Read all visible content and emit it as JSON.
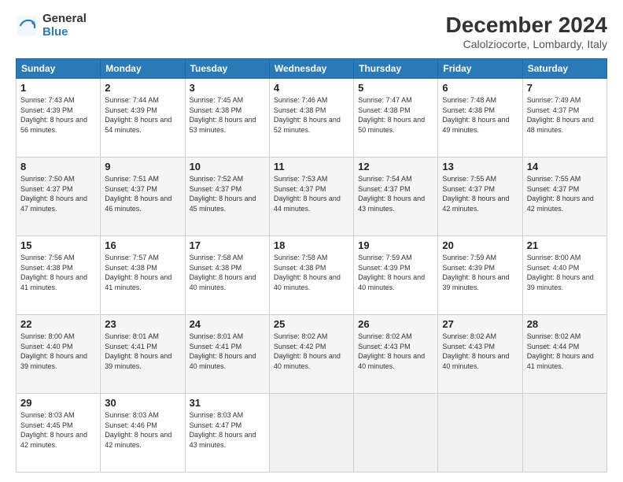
{
  "header": {
    "logo_general": "General",
    "logo_blue": "Blue",
    "month_title": "December 2024",
    "location": "Calolziocorte, Lombardy, Italy"
  },
  "days_of_week": [
    "Sunday",
    "Monday",
    "Tuesday",
    "Wednesday",
    "Thursday",
    "Friday",
    "Saturday"
  ],
  "weeks": [
    [
      {
        "day": 1,
        "sunrise": "7:43 AM",
        "sunset": "4:39 PM",
        "daylight": "8 hours and 56 minutes."
      },
      {
        "day": 2,
        "sunrise": "7:44 AM",
        "sunset": "4:39 PM",
        "daylight": "8 hours and 54 minutes."
      },
      {
        "day": 3,
        "sunrise": "7:45 AM",
        "sunset": "4:38 PM",
        "daylight": "8 hours and 53 minutes."
      },
      {
        "day": 4,
        "sunrise": "7:46 AM",
        "sunset": "4:38 PM",
        "daylight": "8 hours and 52 minutes."
      },
      {
        "day": 5,
        "sunrise": "7:47 AM",
        "sunset": "4:38 PM",
        "daylight": "8 hours and 50 minutes."
      },
      {
        "day": 6,
        "sunrise": "7:48 AM",
        "sunset": "4:38 PM",
        "daylight": "8 hours and 49 minutes."
      },
      {
        "day": 7,
        "sunrise": "7:49 AM",
        "sunset": "4:37 PM",
        "daylight": "8 hours and 48 minutes."
      }
    ],
    [
      {
        "day": 8,
        "sunrise": "7:50 AM",
        "sunset": "4:37 PM",
        "daylight": "8 hours and 47 minutes."
      },
      {
        "day": 9,
        "sunrise": "7:51 AM",
        "sunset": "4:37 PM",
        "daylight": "8 hours and 46 minutes."
      },
      {
        "day": 10,
        "sunrise": "7:52 AM",
        "sunset": "4:37 PM",
        "daylight": "8 hours and 45 minutes."
      },
      {
        "day": 11,
        "sunrise": "7:53 AM",
        "sunset": "4:37 PM",
        "daylight": "8 hours and 44 minutes."
      },
      {
        "day": 12,
        "sunrise": "7:54 AM",
        "sunset": "4:37 PM",
        "daylight": "8 hours and 43 minutes."
      },
      {
        "day": 13,
        "sunrise": "7:55 AM",
        "sunset": "4:37 PM",
        "daylight": "8 hours and 42 minutes."
      },
      {
        "day": 14,
        "sunrise": "7:55 AM",
        "sunset": "4:37 PM",
        "daylight": "8 hours and 42 minutes."
      }
    ],
    [
      {
        "day": 15,
        "sunrise": "7:56 AM",
        "sunset": "4:38 PM",
        "daylight": "8 hours and 41 minutes."
      },
      {
        "day": 16,
        "sunrise": "7:57 AM",
        "sunset": "4:38 PM",
        "daylight": "8 hours and 41 minutes."
      },
      {
        "day": 17,
        "sunrise": "7:58 AM",
        "sunset": "4:38 PM",
        "daylight": "8 hours and 40 minutes."
      },
      {
        "day": 18,
        "sunrise": "7:58 AM",
        "sunset": "4:38 PM",
        "daylight": "8 hours and 40 minutes."
      },
      {
        "day": 19,
        "sunrise": "7:59 AM",
        "sunset": "4:39 PM",
        "daylight": "8 hours and 40 minutes."
      },
      {
        "day": 20,
        "sunrise": "7:59 AM",
        "sunset": "4:39 PM",
        "daylight": "8 hours and 39 minutes."
      },
      {
        "day": 21,
        "sunrise": "8:00 AM",
        "sunset": "4:40 PM",
        "daylight": "8 hours and 39 minutes."
      }
    ],
    [
      {
        "day": 22,
        "sunrise": "8:00 AM",
        "sunset": "4:40 PM",
        "daylight": "8 hours and 39 minutes."
      },
      {
        "day": 23,
        "sunrise": "8:01 AM",
        "sunset": "4:41 PM",
        "daylight": "8 hours and 39 minutes."
      },
      {
        "day": 24,
        "sunrise": "8:01 AM",
        "sunset": "4:41 PM",
        "daylight": "8 hours and 40 minutes."
      },
      {
        "day": 25,
        "sunrise": "8:02 AM",
        "sunset": "4:42 PM",
        "daylight": "8 hours and 40 minutes."
      },
      {
        "day": 26,
        "sunrise": "8:02 AM",
        "sunset": "4:43 PM",
        "daylight": "8 hours and 40 minutes."
      },
      {
        "day": 27,
        "sunrise": "8:02 AM",
        "sunset": "4:43 PM",
        "daylight": "8 hours and 40 minutes."
      },
      {
        "day": 28,
        "sunrise": "8:02 AM",
        "sunset": "4:44 PM",
        "daylight": "8 hours and 41 minutes."
      }
    ],
    [
      {
        "day": 29,
        "sunrise": "8:03 AM",
        "sunset": "4:45 PM",
        "daylight": "8 hours and 42 minutes."
      },
      {
        "day": 30,
        "sunrise": "8:03 AM",
        "sunset": "4:46 PM",
        "daylight": "8 hours and 42 minutes."
      },
      {
        "day": 31,
        "sunrise": "8:03 AM",
        "sunset": "4:47 PM",
        "daylight": "8 hours and 43 minutes."
      },
      null,
      null,
      null,
      null
    ]
  ]
}
